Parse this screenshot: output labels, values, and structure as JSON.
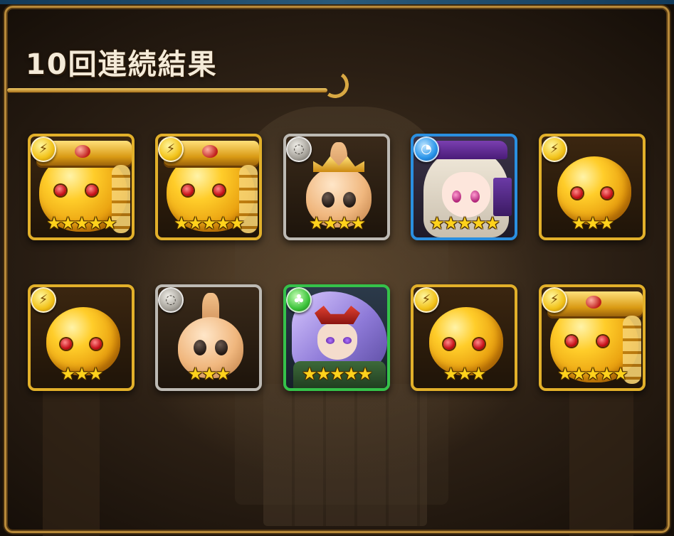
{
  "header": {
    "title": "10回連続結果"
  },
  "attribute_icons": {
    "light": "lightning-icon",
    "none": "blank-orb-icon",
    "water": "water-swirl-icon",
    "wood": "leaf-icon"
  },
  "colors": {
    "frame_gold": "#b88a3a",
    "light_border": "#e2b02a",
    "none_border": "#bdbab4",
    "water_border": "#2a8fe0",
    "wood_border": "#35c24a",
    "star": "#ffd21c"
  },
  "results": [
    {
      "attribute": "light",
      "rarity": 5,
      "stars": "★★★★★",
      "art": "golden-crown-slime"
    },
    {
      "attribute": "light",
      "rarity": 5,
      "stars": "★★★★★",
      "art": "golden-crown-slime"
    },
    {
      "attribute": "none",
      "rarity": 4,
      "stars": "★★★★",
      "art": "crowned-onion-creature"
    },
    {
      "attribute": "water",
      "rarity": 5,
      "stars": "★★★★★",
      "art": "white-haired-girl"
    },
    {
      "attribute": "light",
      "rarity": 3,
      "stars": "★★★",
      "art": "golden-slime"
    },
    {
      "attribute": "light",
      "rarity": 3,
      "stars": "★★★",
      "art": "golden-slime"
    },
    {
      "attribute": "none",
      "rarity": 3,
      "stars": "★★★",
      "art": "onion-creature"
    },
    {
      "attribute": "wood",
      "rarity": 5,
      "stars": "★★★★★",
      "art": "oni-masked-warrior"
    },
    {
      "attribute": "light",
      "rarity": 3,
      "stars": "★★★",
      "art": "golden-slime"
    },
    {
      "attribute": "light",
      "rarity": 5,
      "stars": "★★★★★",
      "art": "golden-crown-slime"
    }
  ]
}
